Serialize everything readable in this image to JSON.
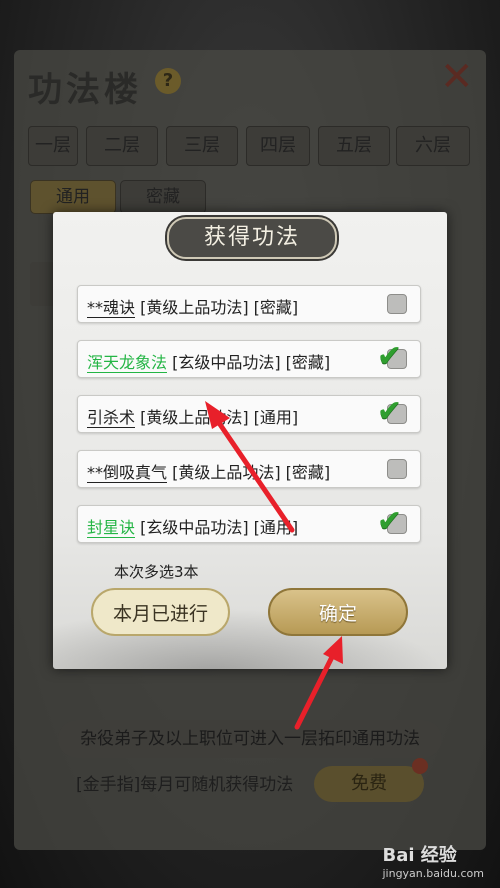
{
  "background": {
    "title": "功法楼",
    "help_icon": "question-mark-icon",
    "close_icon": "close-icon",
    "floor_tabs": [
      "一层",
      "二层",
      "三层",
      "四层",
      "五层",
      "六层"
    ],
    "sub_tabs": [
      "通用",
      "密藏"
    ],
    "banner": "杂役弟子及以上职位可进入一层拓印通用功法",
    "cheat_text": "[金手指]每月可随机获得功法",
    "free_button": "免费"
  },
  "dialog": {
    "title": "获得功法",
    "items": [
      {
        "name": "**魂诀",
        "detail": " [黄级上品功法] [密藏]",
        "name_color": "#222222",
        "checked": false
      },
      {
        "name": "浑天龙象法",
        "detail": " [玄级中品功法] [密藏]",
        "name_color": "#24b545",
        "checked": true
      },
      {
        "name": "引杀术",
        "detail": " [黄级上品功法] [通用]",
        "name_color": "#222222",
        "checked": true
      },
      {
        "name": "**倒吸真气",
        "detail": " [黄级上品功法] [密藏]",
        "name_color": "#222222",
        "checked": false
      },
      {
        "name": "封星诀",
        "detail": " [玄级中品功法] [通用]",
        "name_color": "#24b545",
        "checked": true
      }
    ],
    "hint": "本次多选3本",
    "done_button": "本月已进行",
    "confirm_button": "确定"
  },
  "watermark": {
    "brand": "Bai 经验",
    "url": "jingyan.baidu.com"
  },
  "colors": {
    "accent_green": "#24b545",
    "arrow_red": "#e8202a",
    "gold": "#c6aa66"
  }
}
